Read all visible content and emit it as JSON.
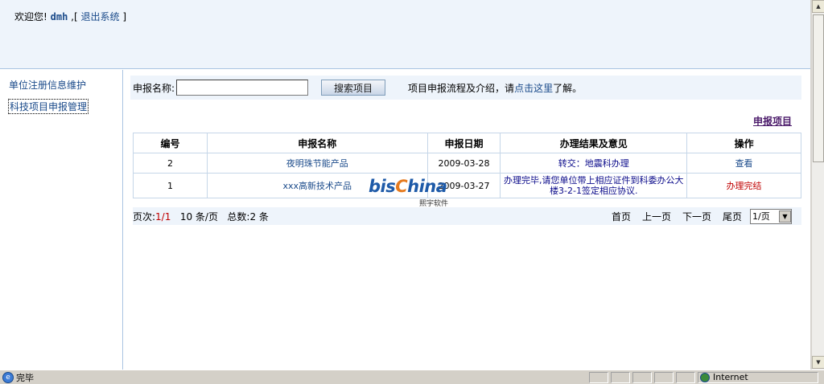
{
  "header": {
    "welcome_prefix": "欢迎您!",
    "username": "dmh",
    "separator_open": ",[",
    "logout_label": "退出系统",
    "separator_close": "]"
  },
  "sidebar": {
    "items": [
      {
        "label": "单位注册信息维护"
      },
      {
        "label": "科技项目申报管理"
      }
    ]
  },
  "search": {
    "label": "申报名称:",
    "value": "",
    "button_label": "搜索项目",
    "intro_prefix": "项目申报流程及介绍，请",
    "intro_link": "点击这里",
    "intro_suffix": "了解。"
  },
  "apply_link": "申报项目",
  "table": {
    "columns": [
      "编号",
      "申报名称",
      "申报日期",
      "办理结果及意见",
      "操作"
    ],
    "rows": [
      {
        "id": "2",
        "name": "夜明珠节能产品",
        "date": "2009-03-28",
        "result": "转交：地震科办理",
        "action": "查看"
      },
      {
        "id": "1",
        "name": "xxx高新技术产品",
        "date": "2009-03-27",
        "result": "办理完毕,请您单位带上相应证件到科委办公大楼3-2-1签定相应协议.",
        "action": "办理完结"
      }
    ]
  },
  "pager": {
    "page_label": "页次:",
    "page_value": "1/1",
    "per_page": "10 条/页",
    "total": "总数:2 条",
    "first": "首页",
    "prev": "上一页",
    "next": "下一页",
    "last": "尾页",
    "select_value": "1/页"
  },
  "watermark": {
    "text_a": "bis",
    "text_b": "C",
    "text_c": "hina",
    "sub": "熙宇软件"
  },
  "statusbar": {
    "status_text": "完毕",
    "zone_label": "Internet"
  }
}
